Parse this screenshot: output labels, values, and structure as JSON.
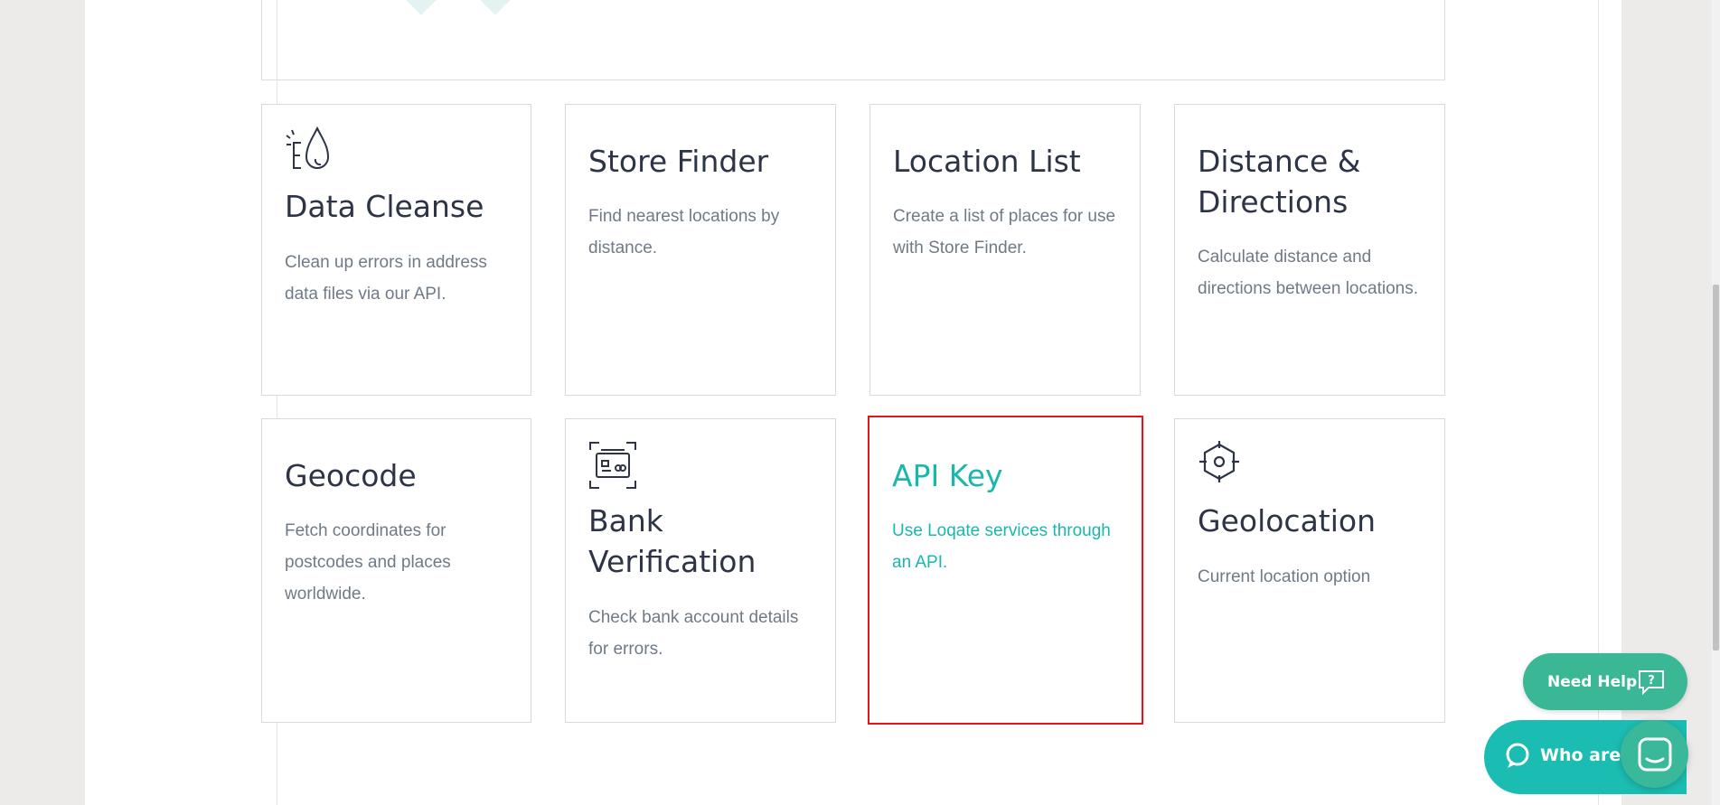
{
  "cards": [
    {
      "title": "Data Cleanse",
      "desc": "Clean up errors in address data files via our API.",
      "icon": "data-cleanse-icon"
    },
    {
      "title": "Store Finder",
      "desc": "Find nearest locations by distance.",
      "icon": ""
    },
    {
      "title": "Location List",
      "desc": "Create a list of places for use with Store Finder.",
      "icon": ""
    },
    {
      "title": "Distance & Directions",
      "desc": "Calculate distance and directions between locations.",
      "icon": ""
    },
    {
      "title": "Geocode",
      "desc": "Fetch coordinates for postcodes and places worldwide.",
      "icon": ""
    },
    {
      "title": "Bank Verification",
      "desc": "Check bank account details for errors.",
      "icon": "bank-card-scan-icon"
    },
    {
      "title": "API Key",
      "desc": "Use Loqate services through an API.",
      "icon": ""
    },
    {
      "title": "Geolocation",
      "desc": "Current location option",
      "icon": "crosshair-icon"
    }
  ],
  "selected_card": "API Key",
  "help": {
    "label": "Need Help",
    "icon": "question-bubble-icon"
  },
  "chat": {
    "text": "Who are y",
    "icon": "chat-bubble-icon",
    "launcher_icon": "messenger-icon"
  },
  "colors": {
    "accent": "#1ab7ac",
    "selected_border": "#e3141c",
    "help_bg": "#3ab795",
    "text_dark": "#2c3446",
    "text_muted": "#707a87"
  }
}
